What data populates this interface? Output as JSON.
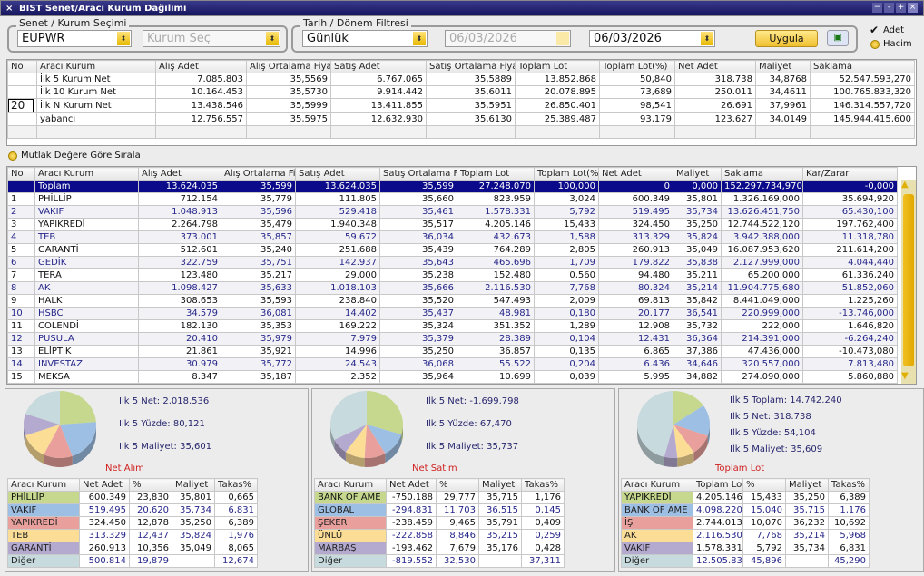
{
  "window": {
    "title": "BIST Senet/Aracı Kurum Dağılımı",
    "controls": [
      "−",
      "-",
      "+",
      "×"
    ]
  },
  "filters": {
    "senet_group_label": "Senet / Kurum Seçimi",
    "symbol": "EUPWR",
    "kurum_placeholder": "Kurum Seç",
    "date_group_label": "Tarih / Dönem Filtresi",
    "period": "Günlük",
    "start_date": "06/03/2026",
    "end_date": "06/03/2026",
    "apply_label": "Uygula",
    "export_icon": "excel-icon",
    "adet_label": "Adet",
    "adet_checked": true,
    "hacim_label": "Hacim"
  },
  "summary_table": {
    "columns": [
      "No",
      "Aracı Kurum",
      "Alış Adet",
      "Alış Ortalama Fiyat",
      "Satış Adet",
      "Satış Ortalama Fiyat",
      "Toplam Lot",
      "Toplam Lot(%)",
      "Net Adet",
      "Maliyet",
      "Saklama"
    ],
    "n_value": "20",
    "rows": [
      [
        "",
        "İlk 5 Kurum Net",
        "7.085.803",
        "35,5569",
        "6.767.065",
        "35,5889",
        "13.852.868",
        "50,840",
        "318.738",
        "34,8768",
        "52.547.593,270"
      ],
      [
        "",
        "İlk 10 Kurum Net",
        "10.164.453",
        "35,5730",
        "9.914.442",
        "35,6011",
        "20.078.895",
        "73,689",
        "250.011",
        "34,4611",
        "100.765.833,320"
      ],
      [
        "",
        "İlk N Kurum Net",
        "13.438.546",
        "35,5999",
        "13.411.855",
        "35,5951",
        "26.850.401",
        "98,541",
        "26.691",
        "37,9961",
        "146.314.557,720"
      ],
      [
        "",
        "yabancı",
        "12.756.557",
        "35,5975",
        "12.632.930",
        "35,6130",
        "25.389.487",
        "93,179",
        "123.627",
        "34,0149",
        "145.944.415,600"
      ],
      [
        "",
        "",
        "",
        "",
        "",
        "",
        "",
        "",
        "",
        "",
        ""
      ]
    ]
  },
  "sort_absolute_label": "Mutlak Değere Göre Sırala",
  "main_table": {
    "columns": [
      "No",
      "Aracı Kurum",
      "Alış Adet",
      "Alış Ortalama Fiy",
      "Satış Adet",
      "Satış Ortalama Fi",
      "Toplam Lot",
      "Toplam Lot(%",
      "Net Adet",
      "Maliyet",
      "Saklama",
      "Kar/Zarar"
    ],
    "rows": [
      [
        "",
        "Toplam",
        "13.624.035",
        "35,599",
        "13.624.035",
        "35,599",
        "27.248.070",
        "100,000",
        "0",
        "0,000",
        "152.297.734,970",
        "-0,000"
      ],
      [
        "1",
        "PHİLLİP",
        "712.154",
        "35,779",
        "111.805",
        "35,660",
        "823.959",
        "3,024",
        "600.349",
        "35,801",
        "1.326.169,000",
        "35.694,920"
      ],
      [
        "2",
        "VAKIF",
        "1.048.913",
        "35,596",
        "529.418",
        "35,461",
        "1.578.331",
        "5,792",
        "519.495",
        "35,734",
        "13.626.451,750",
        "65.430,100"
      ],
      [
        "3",
        "YAPIKREDİ",
        "2.264.798",
        "35,479",
        "1.940.348",
        "35,517",
        "4.205.146",
        "15,433",
        "324.450",
        "35,250",
        "12.744.522,120",
        "197.762,400"
      ],
      [
        "4",
        "TEB",
        "373.001",
        "35,857",
        "59.672",
        "36,034",
        "432.673",
        "1,588",
        "313.329",
        "35,824",
        "3.942.388,000",
        "11.318,780"
      ],
      [
        "5",
        "GARANTİ",
        "512.601",
        "35,240",
        "251.688",
        "35,439",
        "764.289",
        "2,805",
        "260.913",
        "35,049",
        "16.087.953,620",
        "211.614,200"
      ],
      [
        "6",
        "GEDİK",
        "322.759",
        "35,751",
        "142.937",
        "35,643",
        "465.696",
        "1,709",
        "179.822",
        "35,838",
        "2.127.999,000",
        "4.044,440"
      ],
      [
        "7",
        "TERA",
        "123.480",
        "35,217",
        "29.000",
        "35,238",
        "152.480",
        "0,560",
        "94.480",
        "35,211",
        "65.200,000",
        "61.336,240"
      ],
      [
        "8",
        "AK",
        "1.098.427",
        "35,633",
        "1.018.103",
        "35,666",
        "2.116.530",
        "7,768",
        "80.324",
        "35,214",
        "11.904.775,680",
        "51.852,060"
      ],
      [
        "9",
        "HALK",
        "308.653",
        "35,593",
        "238.840",
        "35,520",
        "547.493",
        "2,009",
        "69.813",
        "35,842",
        "8.441.049,000",
        "1.225,260"
      ],
      [
        "10",
        "HSBC",
        "34.579",
        "36,081",
        "14.402",
        "35,437",
        "48.981",
        "0,180",
        "20.177",
        "36,541",
        "220.999,000",
        "-13.746,000"
      ],
      [
        "11",
        "COLENDİ",
        "182.130",
        "35,353",
        "169.222",
        "35,324",
        "351.352",
        "1,289",
        "12.908",
        "35,732",
        "222,000",
        "1.646,820"
      ],
      [
        "12",
        "PUSULA",
        "20.410",
        "35,979",
        "7.979",
        "35,379",
        "28.389",
        "0,104",
        "12.431",
        "36,364",
        "214.391,000",
        "-6.264,240"
      ],
      [
        "13",
        "ELİPTİK",
        "21.861",
        "35,921",
        "14.996",
        "35,250",
        "36.857",
        "0,135",
        "6.865",
        "37,386",
        "47.436,000",
        "-10.473,080"
      ],
      [
        "14",
        "INVESTAZ",
        "30.979",
        "35,772",
        "24.543",
        "36,068",
        "55.522",
        "0,204",
        "6.436",
        "34,646",
        "320.557,000",
        "7.813,480"
      ],
      [
        "15",
        "MEKSA",
        "8.347",
        "35,187",
        "2.352",
        "35,964",
        "10.699",
        "0,039",
        "5.995",
        "34,882",
        "274.090,000",
        "5.860,880"
      ]
    ]
  },
  "slice_colors": [
    "#c5d88e",
    "#9dbfe3",
    "#e9a09c",
    "#fbdd96",
    "#b4a9ce",
    "#c7dadd"
  ],
  "panels": [
    {
      "title": "Net Alım",
      "info": [
        "Ilk 5 Net: 2.018.536",
        "Ilk 5 Yüzde: 80,121",
        "Ilk 5 Maliyet: 35,601"
      ],
      "columns": [
        "Aracı Kurum",
        "Net Adet",
        "%",
        "Maliyet",
        "Takas%"
      ],
      "rows": [
        [
          "PHİLLİP",
          "600.349",
          "23,830",
          "35,801",
          "0,665"
        ],
        [
          "VAKIF",
          "519.495",
          "20,620",
          "35,734",
          "6,831"
        ],
        [
          "YAPIKREDİ",
          "324.450",
          "12,878",
          "35,250",
          "6,389"
        ],
        [
          "TEB",
          "313.329",
          "12,437",
          "35,824",
          "1,976"
        ],
        [
          "GARANTİ",
          "260.913",
          "10,356",
          "35,049",
          "8,065"
        ],
        [
          "Diğer",
          "500.814",
          "19,879",
          "",
          "12,674"
        ]
      ],
      "slices": [
        23.83,
        20.62,
        12.878,
        12.437,
        10.356,
        19.879
      ]
    },
    {
      "title": "Net Satım",
      "info": [
        "Ilk 5 Net: -1.699.798",
        "Ilk 5 Yüzde: 67,470",
        "Ilk 5 Maliyet: 35,737"
      ],
      "columns": [
        "Aracı Kurum",
        "Net Adet",
        "%",
        "Maliyet",
        "Takas%"
      ],
      "rows": [
        [
          "BANK OF AME",
          "-750.188",
          "29,777",
          "35,715",
          "1,176"
        ],
        [
          "GLOBAL",
          "-294.831",
          "11,703",
          "36,515",
          "0,145"
        ],
        [
          "ŞEKER",
          "-238.459",
          "9,465",
          "35,791",
          "0,409"
        ],
        [
          "ÜNLÜ",
          "-222.858",
          "8,846",
          "35,215",
          "0,259"
        ],
        [
          "MARBAŞ",
          "-193.462",
          "7,679",
          "35,176",
          "0,428"
        ],
        [
          "Diğer",
          "-819.552",
          "32,530",
          "",
          "37,311"
        ]
      ],
      "slices": [
        29.777,
        11.703,
        9.465,
        8.846,
        7.679,
        32.53
      ]
    },
    {
      "title": "Toplam Lot",
      "info": [
        "Ilk 5 Toplam: 14.742.240",
        "Ilk 5 Net: 318.738",
        "Ilk 5 Yüzde: 54,104",
        "Ilk 5 Maliyet: 35,609"
      ],
      "columns": [
        "Aracı Kurum",
        "Toplam Lot",
        "%",
        "Maliyet",
        "Takas%"
      ],
      "rows": [
        [
          "YAPIKREDİ",
          "4.205.146",
          "15,433",
          "35,250",
          "6,389"
        ],
        [
          "BANK OF AME",
          "4.098.220",
          "15,040",
          "35,715",
          "1,176"
        ],
        [
          "İŞ",
          "2.744.013",
          "10,070",
          "36,232",
          "10,692"
        ],
        [
          "AK",
          "2.116.530",
          "7,768",
          "35,214",
          "5,968"
        ],
        [
          "VAKIF",
          "1.578.331",
          "5,792",
          "35,734",
          "6,831"
        ],
        [
          "Diğer",
          "12.505.83",
          "45,896",
          "",
          "45,290"
        ]
      ],
      "slices": [
        15.433,
        15.04,
        10.07,
        7.768,
        5.792,
        45.896
      ]
    }
  ]
}
